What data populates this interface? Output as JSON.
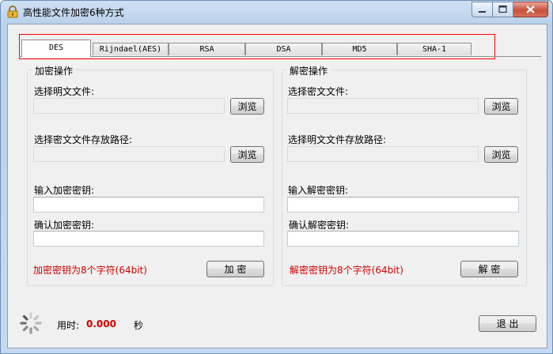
{
  "window": {
    "title": "高性能文件加密6种方式"
  },
  "tabs": [
    {
      "label": "DES",
      "active": true
    },
    {
      "label": "Rijndael(AES)",
      "active": false
    },
    {
      "label": "RSA",
      "active": false
    },
    {
      "label": "DSA",
      "active": false
    },
    {
      "label": "MD5",
      "active": false
    },
    {
      "label": "SHA-1",
      "active": false
    }
  ],
  "encrypt": {
    "group_title": "加密操作",
    "plain_file_label": "选择明文文件:",
    "plain_file_value": "",
    "browse1_label": "浏览",
    "save_path_label": "选择密文文件存放路径:",
    "save_path_value": "",
    "browse2_label": "浏览",
    "key_label": "输入加密密钥:",
    "key_value": "",
    "confirm_label": "确认加密密钥:",
    "confirm_value": "",
    "hint": "加密密钥为8个字符(64bit)",
    "action_label": "加 密"
  },
  "decrypt": {
    "group_title": "解密操作",
    "cipher_file_label": "选择密文文件:",
    "cipher_file_value": "",
    "browse1_label": "浏览",
    "save_path_label": "选择明文文件存放路径:",
    "save_path_value": "",
    "browse2_label": "浏览",
    "key_label": "输入解密密钥:",
    "key_value": "",
    "confirm_label": "确认解密密钥:",
    "confirm_value": "",
    "hint": "解密密钥为8个字符(64bit)",
    "action_label": "解 密"
  },
  "status": {
    "time_label": "用时:",
    "time_value": "0.000",
    "time_unit": "秒"
  },
  "exit_label": "退 出",
  "colors": {
    "hint_red": "#d00000",
    "highlight_red": "#ff0000",
    "panel_bg": "#f0f0f0"
  }
}
